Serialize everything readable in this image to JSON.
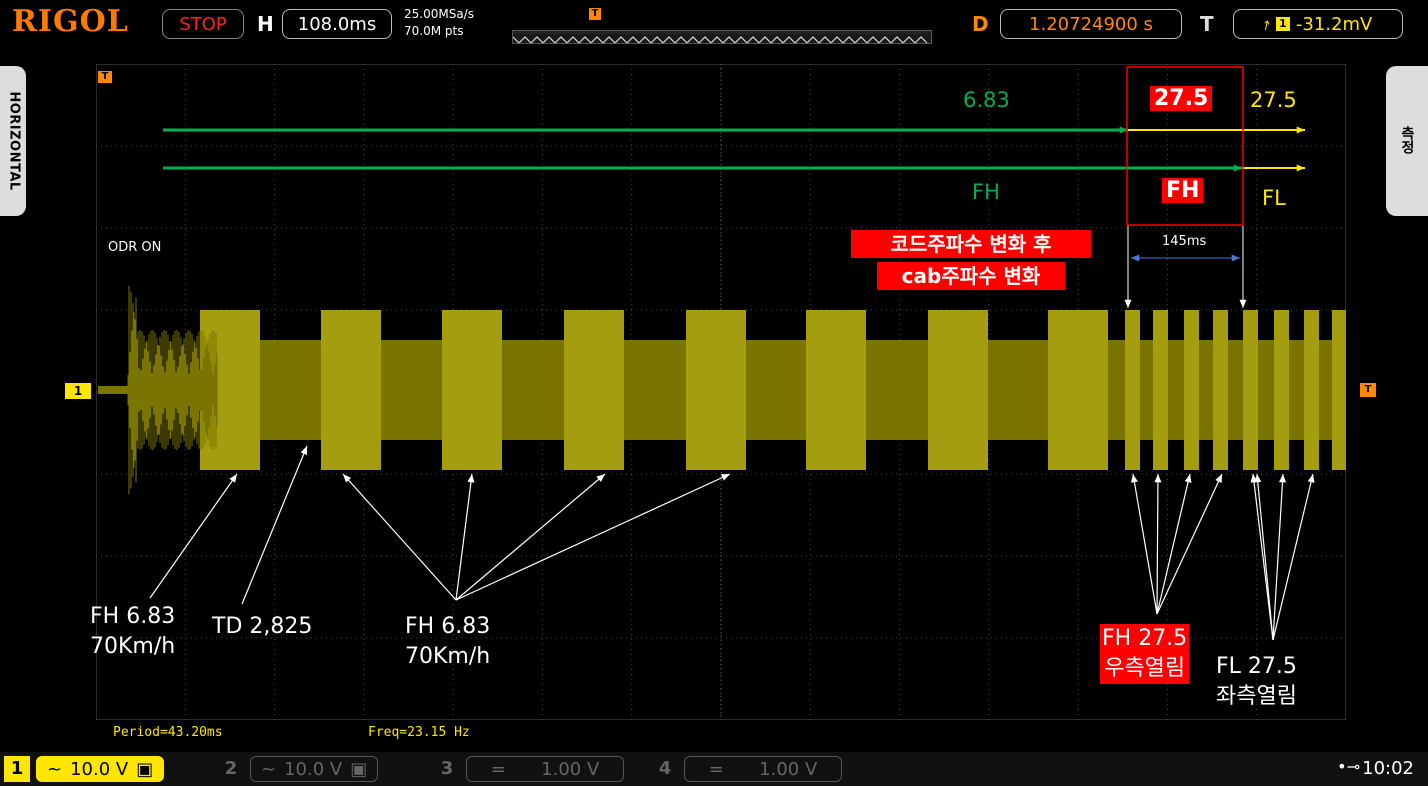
{
  "header": {
    "logo": "RIGOL",
    "run_state": "STOP",
    "h_letter": "H",
    "timebase": "108.0ms",
    "sample_rate": "25.00MSa/s",
    "memory_depth": "70.0M pts",
    "trigger_marker": "T",
    "d_letter": "D",
    "delay": "1.20724900 s",
    "t_letter": "T",
    "trigger_channel": "1",
    "trigger_level": "-31.2mV"
  },
  "side_tabs": {
    "left": "HORIZONTAL",
    "right": "측정"
  },
  "markers": {
    "ch1": "1",
    "trigger_left": "T",
    "trigger_right": "T",
    "trigger_top": "T"
  },
  "annotations": {
    "green_top_value": "6.83",
    "green_bottom_label": "FH",
    "red_box_value": "27.5",
    "red_box_label": "FH",
    "yellow_top_value": "27.5",
    "yellow_bottom_label": "FL",
    "korean_note_line1": "코드주파수 변화 후",
    "korean_note_line2": "cab주파수 변화",
    "interval": "145ms",
    "odr_on": "ODR ON",
    "fh_speed_line1": "FH 6.83",
    "fh_speed_line2": "70Km/h",
    "td_label": "TD 2,825",
    "fh_mid_line1": "FH 6.83",
    "fh_mid_line2": "70Km/h",
    "fh_right_line1": "FH 27.5",
    "fh_right_line2": "우측열림",
    "fl_right_line1": "FL 27.5",
    "fl_right_line2": "좌측열림"
  },
  "measurements": {
    "period": "Period=43.20ms",
    "freq": "Freq=23.15 Hz"
  },
  "channels": [
    {
      "num": "1",
      "coupling_icon": "~",
      "scale": "10.0 V",
      "active": true,
      "color": "#ffe600"
    },
    {
      "num": "2",
      "coupling_icon": "~",
      "scale": "10.0 V",
      "active": false,
      "color": "#666666"
    },
    {
      "num": "3",
      "coupling_icon": "=",
      "scale": "1.00 V",
      "active": false,
      "color": "#666666"
    },
    {
      "num": "4",
      "coupling_icon": "=",
      "scale": "1.00 V",
      "active": false,
      "color": "#666666"
    }
  ],
  "status": {
    "usb_icon": "usb-icon",
    "time": "10:02"
  },
  "colors": {
    "trace": "#7a7500",
    "trace_bright": "#a49d10",
    "annotation_green": "#00b050",
    "annotation_yellow": "#ffe600",
    "highlight_red": "#ff0000",
    "accent_orange": "#ff8800"
  }
}
